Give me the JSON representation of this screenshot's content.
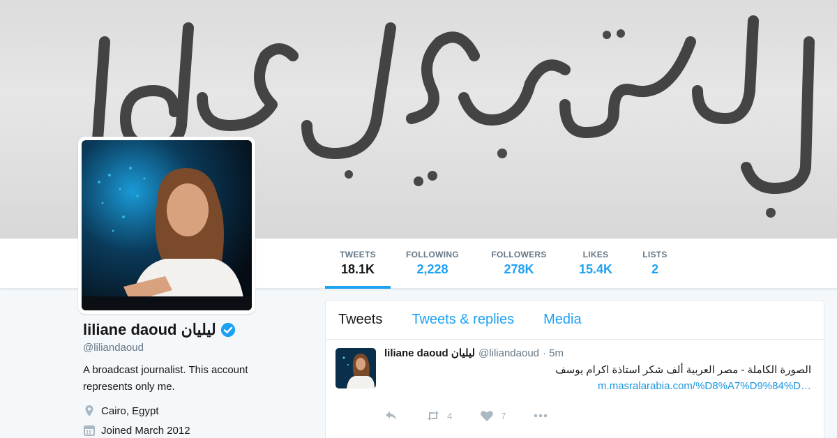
{
  "profile": {
    "display_name": "liliane daoud ليليان",
    "handle": "@liliandaoud",
    "bio": "A broadcast journalist. This account represents only me.",
    "location": "Cairo, Egypt",
    "joined": "Joined March 2012",
    "icons": {
      "verified": "verified-badge-icon",
      "location": "map-pin-icon",
      "joined": "calendar-icon"
    }
  },
  "stats": [
    {
      "label": "TWEETS",
      "value": "18.1K"
    },
    {
      "label": "FOLLOWING",
      "value": "2,228"
    },
    {
      "label": "FOLLOWERS",
      "value": "278K"
    },
    {
      "label": "LIKES",
      "value": "15.4K"
    },
    {
      "label": "LISTS",
      "value": "2"
    }
  ],
  "timeline": {
    "tabs": [
      "Tweets",
      "Tweets & replies",
      "Media"
    ],
    "tweet": {
      "name": "liliane daoud ليليان",
      "handle": "@liliandaoud",
      "time": "· 5m",
      "text": "الصورة الكاملة - مصر العربية ألف شكر استاذة اكرام يوسف",
      "link": "m.masralarabia.com/%D8%A7%D9%84%D…",
      "retweets": "4",
      "likes": "7"
    }
  },
  "colors": {
    "accent": "#1da1f2",
    "text": "#14171a",
    "muted": "#657786",
    "background": "#f5f8fa"
  }
}
